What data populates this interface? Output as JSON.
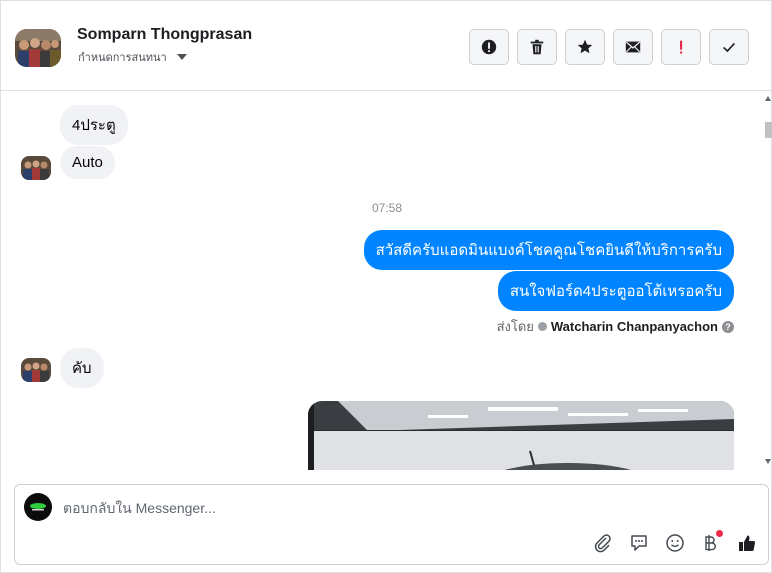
{
  "header": {
    "contact_name": "Somparn Thongprasan",
    "assign_label": "กำหนดการสนทนา",
    "actions": [
      {
        "icon": "alert-circle-icon",
        "name": "mark-spam-button"
      },
      {
        "icon": "trash-icon",
        "name": "delete-button"
      },
      {
        "icon": "star-icon",
        "name": "star-button"
      },
      {
        "icon": "envelope-icon",
        "name": "mark-unread-button"
      },
      {
        "icon": "exclamation-icon",
        "name": "follow-up-button"
      },
      {
        "icon": "checkmark-icon",
        "name": "mark-done-button"
      }
    ]
  },
  "messages": {
    "in_1": "4ประตู",
    "in_2": "Auto",
    "timestamp": "07:58",
    "out_1": "สวัสดีครับแอดมินแบงค์โชคคูณโชคยินดีให้บริการครับ",
    "out_2": "สนใจฟอร์ด4ประตูออโต้เหรอครับ",
    "sent_by_prefix": "ส่งโดย",
    "sent_by_agent": "Watcharin Chanpanyachon",
    "help": "?",
    "in_3": "คับ"
  },
  "composer": {
    "placeholder": "ตอบกลับใน Messenger...",
    "value": ""
  },
  "colors": {
    "outgoing_bubble": "#0084ff",
    "incoming_bubble": "#f0f2f5",
    "notification_dot": "#f02849",
    "follow_up_red": "#e41e3f"
  }
}
